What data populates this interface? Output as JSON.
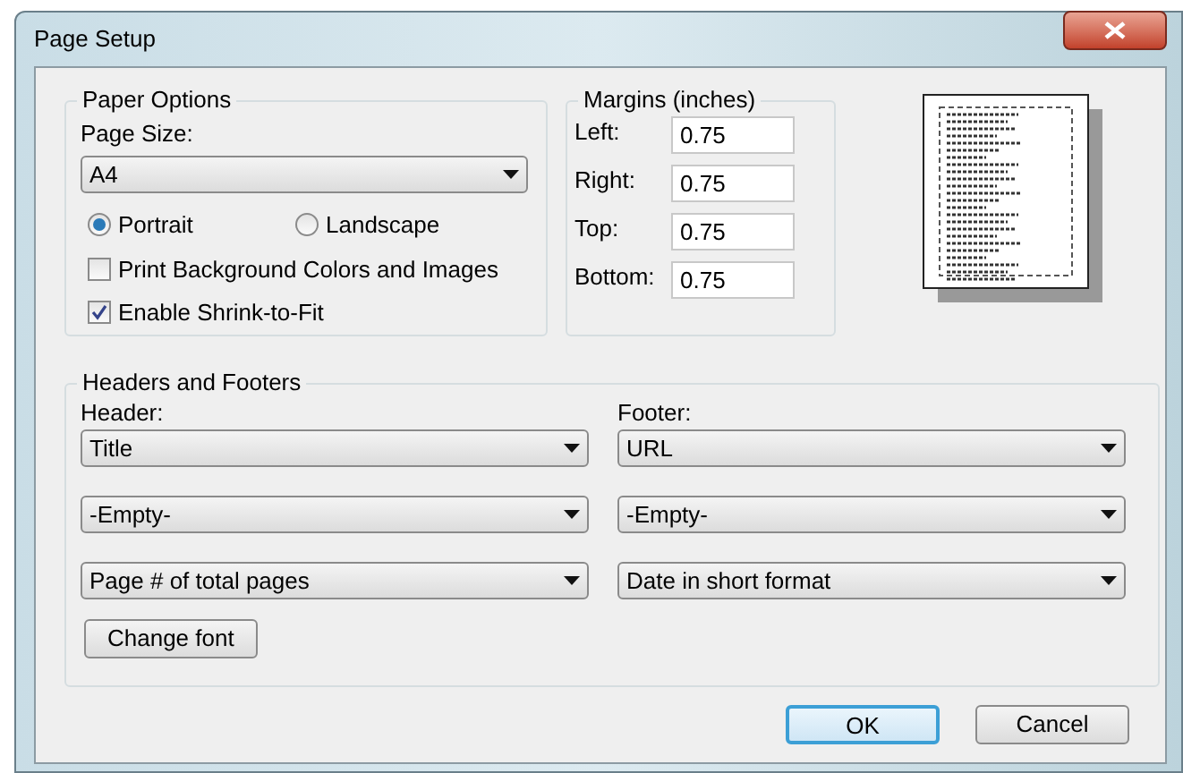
{
  "window": {
    "title": "Page Setup"
  },
  "paper_options": {
    "title": "Paper Options",
    "page_size_label": "Page Size:",
    "page_size": "A4",
    "orientation": [
      {
        "label": "Portrait",
        "selected": true
      },
      {
        "label": "Landscape",
        "selected": false
      }
    ],
    "options": [
      {
        "label": "Print Background Colors and Images",
        "checked": false
      },
      {
        "label": "Enable Shrink-to-Fit",
        "checked": true
      }
    ]
  },
  "margins": {
    "title": "Margins (inches)",
    "fields": [
      {
        "label": "Left:",
        "value": "0.75"
      },
      {
        "label": "Right:",
        "value": "0.75"
      },
      {
        "label": "Top:",
        "value": "0.75"
      },
      {
        "label": "Bottom:",
        "value": "0.75"
      }
    ]
  },
  "headers_footers": {
    "title": "Headers and Footers",
    "header_label": "Header:",
    "footer_label": "Footer:",
    "header": [
      "Title",
      "-Empty-",
      "Page # of total pages"
    ],
    "footer": [
      "URL",
      "-Empty-",
      "Date in short format"
    ],
    "change_font": "Change font"
  },
  "buttons": [
    {
      "label": "OK",
      "default": true
    },
    {
      "label": "Cancel",
      "default": false
    }
  ]
}
